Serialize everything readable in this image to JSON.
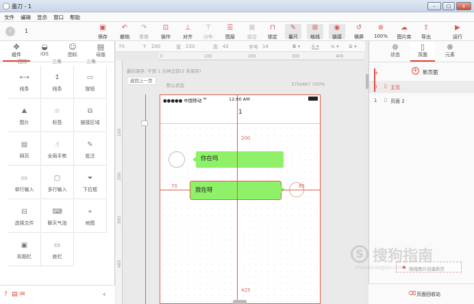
{
  "window": {
    "title": "墨刀 - 1",
    "controls": [
      "–",
      "▢",
      "x"
    ]
  },
  "menu": [
    "文件",
    "编辑",
    "显示",
    "窗口",
    "帮助"
  ],
  "toolbar": {
    "page_number": "1",
    "buttons": [
      {
        "label": "保存",
        "icon": "save-icon",
        "glyph": "▣",
        "dim": false
      },
      {
        "label": "撤销",
        "icon": "undo-icon",
        "glyph": "↶",
        "dim": false
      },
      {
        "label": "重做",
        "icon": "redo-icon",
        "glyph": "↷",
        "dim": true
      },
      {
        "label": "操作",
        "icon": "operate-icon",
        "glyph": "⊡",
        "dim": false
      },
      {
        "label": "对齐",
        "icon": "align-icon",
        "glyph": "⊥",
        "dim": false
      },
      {
        "label": "分布",
        "icon": "distribute-icon",
        "glyph": "⊤",
        "dim": true
      },
      {
        "label": "图层",
        "icon": "layer-icon",
        "glyph": "☰",
        "dim": false
      },
      {
        "label": "组合",
        "icon": "group-icon",
        "glyph": "⊞",
        "dim": true
      },
      {
        "label": "锁定",
        "icon": "lock-icon",
        "glyph": "⊓",
        "dim": false
      },
      {
        "label": "量尺",
        "icon": "ruler-icon",
        "glyph": "✎",
        "dim": false
      },
      {
        "label": "格线",
        "icon": "grid-icon",
        "glyph": "⊞",
        "dim": false
      },
      {
        "label": "链接",
        "icon": "link-icon",
        "glyph": "◉",
        "dim": false
      },
      {
        "label": "横屏",
        "icon": "rotate-icon",
        "glyph": "↺",
        "dim": false
      },
      {
        "label": "100%",
        "icon": "zoom-icon",
        "glyph": "⊕",
        "dim": false
      },
      {
        "label": "图片库",
        "icon": "image-library-icon",
        "glyph": "☁",
        "dim": false
      },
      {
        "label": "导出",
        "icon": "export-icon",
        "glyph": "⇪",
        "dim": false
      },
      {
        "label": "运行",
        "icon": "run-icon",
        "glyph": "▶",
        "dim": false
      }
    ]
  },
  "left_tabs": [
    {
      "label": "组件",
      "icon": "widget-icon",
      "glyph": "✥"
    },
    {
      "label": "iOS",
      "icon": "apple-icon",
      "glyph": "◒"
    },
    {
      "label": "图标",
      "icon": "smiley-icon",
      "glyph": "☺"
    },
    {
      "label": "母版",
      "icon": "master-icon",
      "glyph": "▤"
    }
  ],
  "components_top_row": [
    "园形",
    "三角",
    "三角"
  ],
  "components": [
    {
      "label": "线条",
      "icon": "horizontal-line-icon",
      "glyph": "⟷"
    },
    {
      "label": "线条",
      "icon": "vertical-line-icon",
      "glyph": "↕"
    },
    {
      "label": "按钮",
      "icon": "button-icon",
      "glyph": "▭"
    },
    {
      "label": "图片",
      "icon": "image-icon",
      "glyph": "⛰"
    },
    {
      "label": "标签",
      "icon": "star-icon",
      "glyph": "☆"
    },
    {
      "label": "链接区域",
      "icon": "link-area-icon",
      "glyph": "⧉"
    },
    {
      "label": "网页",
      "icon": "webpage-icon",
      "glyph": "▤"
    },
    {
      "label": "全局手势",
      "icon": "gesture-icon",
      "glyph": "☝"
    },
    {
      "label": "批注",
      "icon": "annotation-icon",
      "glyph": "✎"
    },
    {
      "label": "单行输入",
      "icon": "single-input-icon",
      "glyph": "▭"
    },
    {
      "label": "多行输入",
      "icon": "multi-input-icon",
      "glyph": "▢"
    },
    {
      "label": "下拉框",
      "icon": "dropdown-icon",
      "glyph": "⏷"
    },
    {
      "label": "选择文件",
      "icon": "file-select-icon",
      "glyph": "⊟"
    },
    {
      "label": "聊天气泡",
      "icon": "chat-bubble-icon",
      "glyph": "⌨"
    },
    {
      "label": "地图",
      "icon": "map-icon",
      "glyph": "⌖"
    },
    {
      "label": "标题栏",
      "icon": "titlebar-icon",
      "glyph": "▣"
    },
    {
      "label": "底栏",
      "icon": "bottombar-icon",
      "glyph": "▭"
    }
  ],
  "props": {
    "x": "70",
    "y_label": "Y",
    "y": "200",
    "w_label": "宽",
    "w": "220",
    "h_label": "高",
    "h": "42",
    "font_label": "字号",
    "font": "14"
  },
  "ruler_ticks_h": [
    "0",
    "100",
    "200",
    "300",
    "400"
  ],
  "ruler_ticks_v": [
    "100",
    "200",
    "300",
    "400"
  ],
  "canvas": {
    "autosave": "最后保存: 不到 1 分钟之前(2 未保存)",
    "back_button": "返回上一页",
    "state": "默认状态",
    "size": "375x667 100%"
  },
  "phone": {
    "carrier": "●●●●● 中国移动",
    "wifi": "≈",
    "time": "12:00 AM",
    "nav_title": "1",
    "bubble_left": "你在吗",
    "bubble_right": "我在呀",
    "measure_top": "200",
    "measure_left": "70",
    "measure_right": "85",
    "measure_bottom": "425"
  },
  "right_tabs": [
    {
      "label": "状态",
      "icon": "state-icon",
      "glyph": "⊚"
    },
    {
      "label": "页面",
      "icon": "page-icon",
      "glyph": "▯"
    },
    {
      "label": "元素",
      "icon": "element-icon",
      "glyph": "⊗"
    }
  ],
  "pages": {
    "add_label": "新页面",
    "list": [
      {
        "index": "0",
        "name": "主页",
        "active": true
      },
      {
        "index": "1",
        "name": "页面 2",
        "active": false
      }
    ],
    "drop_hint": "拖拽图片创建新页",
    "recycle": "页面回收站"
  },
  "watermark": {
    "main": "搜狗指南",
    "sub": "zhinan.sogou.com"
  },
  "colors": {
    "accent": "#e0463a",
    "bubble": "#8ff06a",
    "guide": "#e05b48"
  }
}
